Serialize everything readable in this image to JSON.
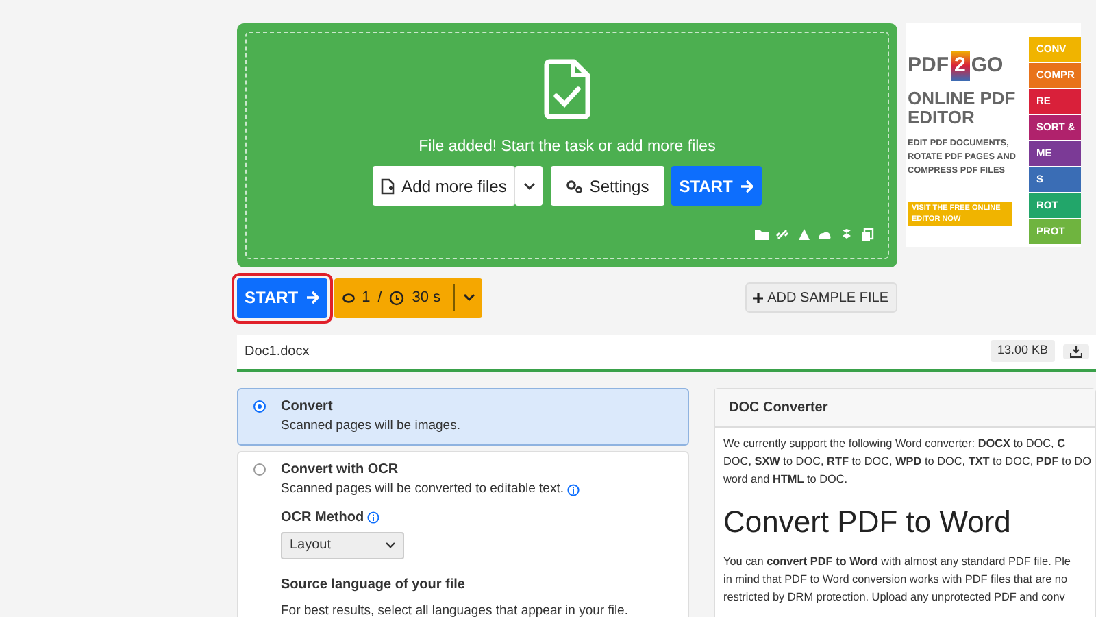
{
  "upload": {
    "message": "File added! Start the task or add more files",
    "add_button": "Add more files",
    "settings_button": "Settings",
    "start_button": "START"
  },
  "toolbar": {
    "start_button": "START",
    "highlighted": true,
    "credits": "1",
    "separator": "/",
    "time": "30 s",
    "sample_button": "ADD SAMPLE FILE"
  },
  "file": {
    "name": "Doc1.docx",
    "size": "13.00 KB"
  },
  "options": [
    {
      "title": "Convert",
      "description": "Scanned pages will be images.",
      "selected": true,
      "info": false
    },
    {
      "title": "Convert with OCR",
      "description": "Scanned pages will be converted to editable text.",
      "selected": false,
      "info": true
    }
  ],
  "ocr": {
    "method_label": "OCR Method",
    "method_value": "Layout",
    "language_label": "Source language of your file",
    "language_hint": "For best results, select all languages that appear in your file."
  },
  "info_card": {
    "title": "DOC Converter",
    "intro_lines": [
      "We currently support the following Word converter: **DOCX** to DOC, **C**",
      "DOC, **SXW** to DOC, **RTF** to DOC, **WPD** to DOC, **TXT** to DOC, **PDF** to DO",
      "word and **HTML** to DOC."
    ],
    "heading": "Convert PDF to Word",
    "body_lines": [
      "You can **convert PDF to Word** with almost any standard PDF file. Ple",
      "in mind that PDF to Word conversion works with PDF files that are no",
      "restricted by DRM protection. Upload any unprotected PDF and conv"
    ]
  },
  "ad": {
    "logo_left": "PDF",
    "logo_mid": "2",
    "logo_right": "GO",
    "title": "ONLINE PDF EDITOR",
    "text": "EDIT PDF DOCUMENTS, ROTATE PDF PAGES AND COMPRESS PDF FILES",
    "cta": "VISIT THE FREE ONLINE EDITOR NOW",
    "stripes": [
      {
        "label": "CONV",
        "color": "#f0b400"
      },
      {
        "label": "COMPR",
        "color": "#e8731a"
      },
      {
        "label": "RE",
        "color": "#d9203a"
      },
      {
        "label": "SORT &",
        "color": "#b0226c"
      },
      {
        "label": "ME",
        "color": "#7b3a96"
      },
      {
        "label": "S",
        "color": "#3a6db5"
      },
      {
        "label": "ROT",
        "color": "#22a66a"
      },
      {
        "label": "PROT",
        "color": "#6fb43f"
      }
    ]
  }
}
